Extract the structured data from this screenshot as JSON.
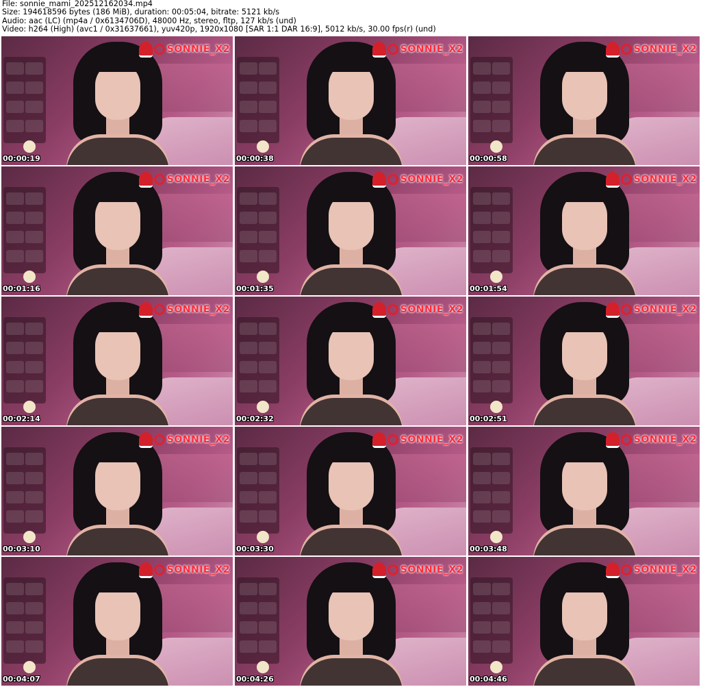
{
  "header": {
    "file": "File: sonnie_mami_202512162034.mp4",
    "size": "Size: 194618596 bytes (186 MiB), duration: 00:05:04, bitrate: 5121 kb/s",
    "audio": "Audio: aac (LC) (mp4a / 0x6134706D), 48000 Hz, stereo, fltp, 127 kb/s (und)",
    "video": "Video: h264 (High) (avc1 / 0x31637661), yuv420p, 1920x1080 [SAR 1:1 DAR 16:9], 5012 kb/s, 30.00 fps(r) (und)"
  },
  "watermark": "SONNIE_X2",
  "thumbnails": [
    {
      "time": "00:00:19"
    },
    {
      "time": "00:00:38"
    },
    {
      "time": "00:00:58"
    },
    {
      "time": "00:01:16"
    },
    {
      "time": "00:01:35"
    },
    {
      "time": "00:01:54"
    },
    {
      "time": "00:02:14"
    },
    {
      "time": "00:02:32"
    },
    {
      "time": "00:02:51"
    },
    {
      "time": "00:03:10"
    },
    {
      "time": "00:03:30"
    },
    {
      "time": "00:03:48"
    },
    {
      "time": "00:04:07"
    },
    {
      "time": "00:04:26"
    },
    {
      "time": "00:04:46"
    }
  ]
}
